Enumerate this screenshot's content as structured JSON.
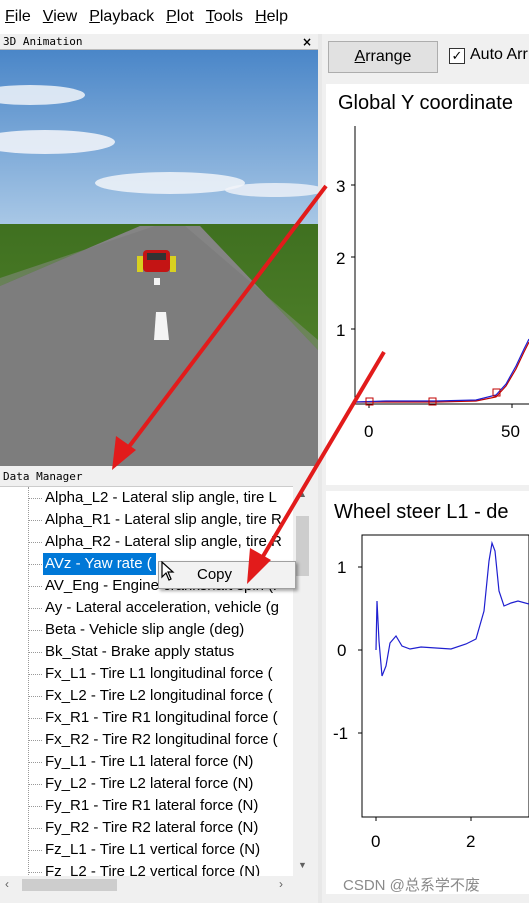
{
  "menubar": {
    "items": [
      {
        "mnemonic": "F",
        "rest": "ile"
      },
      {
        "mnemonic": "V",
        "rest": "iew"
      },
      {
        "mnemonic": "P",
        "rest": "layback"
      },
      {
        "mnemonic": "P",
        "rest": "lot"
      },
      {
        "mnemonic": "T",
        "rest": "ools"
      },
      {
        "mnemonic": "H",
        "rest": "elp"
      }
    ]
  },
  "animation_panel": {
    "title": "3D Animation",
    "close_glyph": "×"
  },
  "data_manager": {
    "title": "Data Manager",
    "items": [
      "Alpha_L2 - Lateral slip angle, tire L",
      "Alpha_R1 - Lateral slip angle, tire R",
      "Alpha_R2 - Lateral slip angle, tire R",
      "AVz - Yaw rate (",
      "AV_Eng - Engine crankshaft spin (r",
      "Ay - Lateral acceleration, vehicle (g",
      "Beta - Vehicle slip angle (deg)",
      "Bk_Stat - Brake apply status",
      "Fx_L1 - Tire L1 longitudinal force (",
      "Fx_L2 - Tire L2 longitudinal force (",
      "Fx_R1 - Tire R1 longitudinal force (",
      "Fx_R2 - Tire R2 longitudinal force (",
      "Fy_L1 - Tire L1 lateral force (N)",
      "Fy_L2 - Tire L2 lateral force (N)",
      "Fy_R1 - Tire R1 lateral force (N)",
      "Fy_R2 - Tire R2 lateral force (N)",
      "Fz_L1 - Tire L1 vertical force (N)",
      "Fz_L2 - Tire L2 vertical force (N)"
    ],
    "selected_index": 3
  },
  "context_menu": {
    "items": [
      "Copy"
    ]
  },
  "toolbar": {
    "arrange_mnemonic": "A",
    "arrange_rest": "rrange",
    "auto_label": "Auto Arr",
    "auto_checked": true,
    "check_glyph": "✓"
  },
  "plots": {
    "top": {
      "title": "Global Y coordinate",
      "y_ticks": [
        "3",
        "2",
        "1"
      ],
      "x_ticks": [
        "0",
        "50"
      ]
    },
    "bottom": {
      "title": "Wheel steer L1 - de",
      "y_ticks": [
        "1",
        "0",
        "-1"
      ],
      "x_ticks": [
        "0",
        "2"
      ]
    }
  },
  "watermark": "CSDN @总系学不废",
  "colors": {
    "selection": "#0078d7",
    "plot_line_blue": "#1f1fd0",
    "plot_line_red": "#c00000",
    "arrow_red": "#e21b1b",
    "sky_top": "#4a86c8",
    "grass": "#4d7f26",
    "road": "#7d7d7d"
  }
}
